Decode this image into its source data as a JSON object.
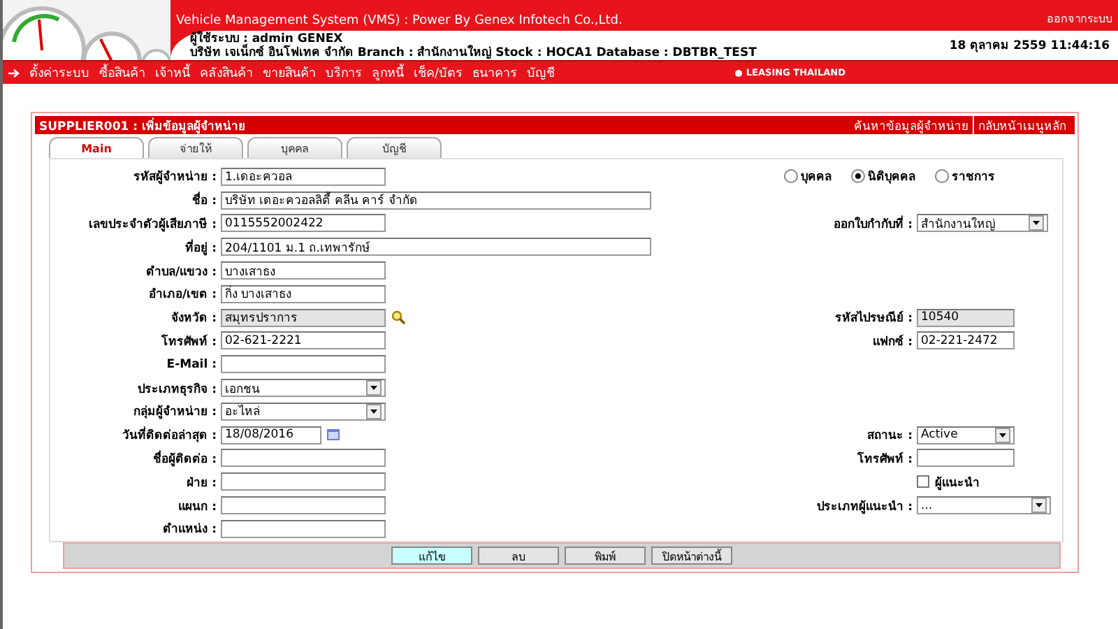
{
  "header": {
    "title": "Vehicle Management System (VMS)  : Power By Genex Infotech Co.,Ltd.",
    "logout": "ออกจากระบบ",
    "user_line": "ผู้ใช้ระบบ : admin GENEX",
    "company_line": "บริษัท เจเน็กซ์ อินโฟเทค จำกัด Branch : สำนักงานใหญ่ Stock : HOCA1 Database : DBTBR_TEST",
    "datetime": "18 ตุลาคม 2559 11:44:16"
  },
  "menu": {
    "items": [
      "ตั้งค่าระบบ",
      "ซื้อสินค้า",
      "เจ้าหนี้",
      "คลังสินค้า",
      "ขายสินค้า",
      "บริการ",
      "ลูกหนี้",
      "เช็ค/บัตร",
      "ธนาคาร",
      "บัญชี"
    ],
    "brand": "LEASING THAILAND"
  },
  "panel": {
    "title": "SUPPLIER001 : เพิ่มข้อมูลผู้จำหน่าย",
    "links": [
      "ค้นหาข้อมูลผู้จำหน่าย",
      "กลับหน้าเมนูหลัก"
    ]
  },
  "tabs": [
    {
      "label": "Main",
      "selected": true
    },
    {
      "label": "จ่ายให้",
      "selected": false
    },
    {
      "label": "บุคคล",
      "selected": false
    },
    {
      "label": "บัญชี",
      "selected": false
    }
  ],
  "rows": [
    {
      "left": {
        "label": "รหัสผู้จำหน่าย :",
        "kind": "text",
        "value": "1.เดอะควอล"
      },
      "right": {
        "kind": "radios",
        "options": [
          {
            "label": "บุคคล",
            "selected": false
          },
          {
            "label": "นิติบุคคล",
            "selected": true
          },
          {
            "label": "ราชการ",
            "selected": false
          }
        ]
      }
    },
    {
      "left": {
        "label": "ชื่อ :",
        "kind": "wide",
        "value": "บริษัท เดอะควอลลิตี้ คลีน คาร์ จำกัด"
      }
    },
    {
      "left": {
        "label": "เลขประจำตัวผู้เสียภาษี :",
        "kind": "text",
        "value": "0115552002422"
      },
      "right": {
        "kind": "select",
        "label": "ออกใบกำกับที่ :",
        "value": "สำนักงานใหญ่"
      }
    },
    {
      "left": {
        "label": "ที่อยู่ :",
        "kind": "wide",
        "value": "204/1101 ม.1 ถ.เทพารักษ์"
      }
    },
    {
      "left": {
        "label": "ตำบล/แขวง :",
        "kind": "text",
        "value": "บางเสาธง"
      }
    },
    {
      "left": {
        "label": "อำเภอ/เขต :",
        "kind": "text",
        "value": "กิ่ง บางเสาธง"
      }
    },
    {
      "left": {
        "label": "จังหวัด :",
        "kind": "lookup",
        "value": "สมุทรปราการ",
        "disabled": true
      },
      "right": {
        "kind": "text",
        "label": "รหัสไปรษณีย์ :",
        "value": "10540",
        "disabled": true
      }
    },
    {
      "left": {
        "label": "โทรศัพท์ :",
        "kind": "text",
        "value": "02-621-2221"
      },
      "right": {
        "kind": "text",
        "label": "แฟกซ์ :",
        "value": "02-221-2472"
      }
    },
    {
      "left": {
        "label": "E-Mail :",
        "kind": "text"
      }
    },
    {
      "left": {
        "label": "ประเภทธุรกิจ :",
        "kind": "select",
        "value": "เอกชน"
      }
    },
    {
      "left": {
        "label": "กลุ่มผู้จำหน่าย :",
        "kind": "select",
        "value": "อะไหล่"
      }
    },
    {
      "left": {
        "label": "วันที่ติดต่อล่าสุด :",
        "kind": "date",
        "value": "18/08/2016"
      },
      "right": {
        "kind": "select",
        "label": "สถานะ :",
        "value": "Active"
      }
    },
    {
      "left": {
        "label": "ชื่อผู้ติดต่อ :",
        "kind": "text"
      },
      "right": {
        "kind": "text",
        "label": "โทรศัพท์ :"
      }
    },
    {
      "left": {
        "label": "ฝ่าย :",
        "kind": "text"
      },
      "right": {
        "kind": "checkbox",
        "label": "ผู้แนะนำ",
        "checked": false
      }
    },
    {
      "left": {
        "label": "แผนก :",
        "kind": "text"
      },
      "right": {
        "kind": "select",
        "label": "ประเภทผู้แนะนำ :",
        "value": "..."
      }
    },
    {
      "left": {
        "label": "ตำแหน่ง :",
        "kind": "text"
      }
    }
  ],
  "buttons": [
    {
      "label": "แก้ไข",
      "selected": true
    },
    {
      "label": "ลบ",
      "selected": false
    },
    {
      "label": "พิมพ์",
      "selected": false
    },
    {
      "label": "ปิดหน้าต่างนี้",
      "selected": false
    }
  ]
}
